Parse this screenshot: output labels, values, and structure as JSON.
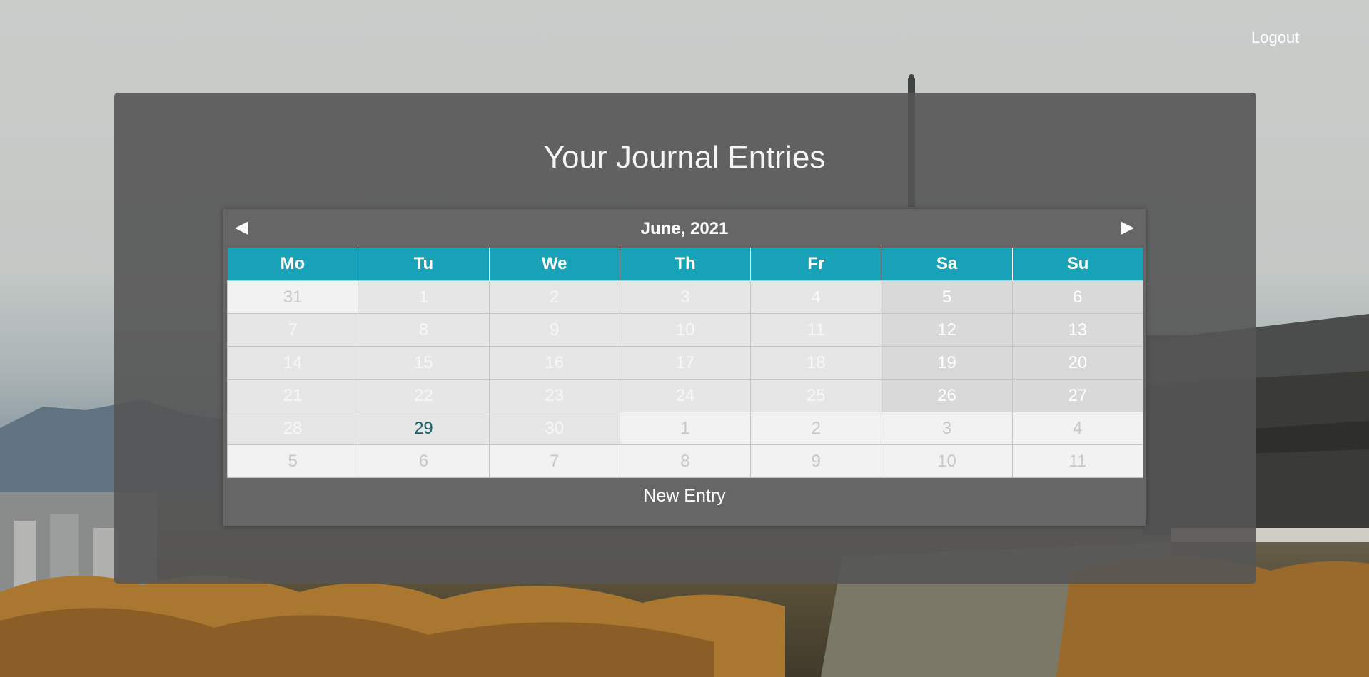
{
  "header": {
    "logout_label": "Logout"
  },
  "page": {
    "title": "Your Journal Entries"
  },
  "calendar": {
    "month_label": "June, 2021",
    "prev_icon": "◀",
    "next_icon": "▶",
    "weekdays": [
      "Mo",
      "Tu",
      "We",
      "Th",
      "Fr",
      "Sa",
      "Su"
    ],
    "weeks": [
      [
        {
          "day": "31",
          "state": "outside"
        },
        {
          "day": "1",
          "state": "in-month"
        },
        {
          "day": "2",
          "state": "in-month"
        },
        {
          "day": "3",
          "state": "in-month"
        },
        {
          "day": "4",
          "state": "in-month"
        },
        {
          "day": "5",
          "state": "weekend"
        },
        {
          "day": "6",
          "state": "weekend"
        }
      ],
      [
        {
          "day": "7",
          "state": "in-month"
        },
        {
          "day": "8",
          "state": "in-month"
        },
        {
          "day": "9",
          "state": "in-month"
        },
        {
          "day": "10",
          "state": "in-month"
        },
        {
          "day": "11",
          "state": "in-month"
        },
        {
          "day": "12",
          "state": "weekend"
        },
        {
          "day": "13",
          "state": "weekend"
        }
      ],
      [
        {
          "day": "14",
          "state": "in-month"
        },
        {
          "day": "15",
          "state": "in-month"
        },
        {
          "day": "16",
          "state": "in-month"
        },
        {
          "day": "17",
          "state": "in-month"
        },
        {
          "day": "18",
          "state": "in-month"
        },
        {
          "day": "19",
          "state": "weekend"
        },
        {
          "day": "20",
          "state": "weekend"
        }
      ],
      [
        {
          "day": "21",
          "state": "in-month"
        },
        {
          "day": "22",
          "state": "in-month"
        },
        {
          "day": "23",
          "state": "in-month"
        },
        {
          "day": "24",
          "state": "in-month"
        },
        {
          "day": "25",
          "state": "in-month"
        },
        {
          "day": "26",
          "state": "weekend"
        },
        {
          "day": "27",
          "state": "weekend"
        }
      ],
      [
        {
          "day": "28",
          "state": "in-month"
        },
        {
          "day": "29",
          "state": "today"
        },
        {
          "day": "30",
          "state": "in-month"
        },
        {
          "day": "1",
          "state": "outside"
        },
        {
          "day": "2",
          "state": "outside"
        },
        {
          "day": "3",
          "state": "outside"
        },
        {
          "day": "4",
          "state": "outside"
        }
      ],
      [
        {
          "day": "5",
          "state": "outside"
        },
        {
          "day": "6",
          "state": "outside"
        },
        {
          "day": "7",
          "state": "outside"
        },
        {
          "day": "8",
          "state": "outside"
        },
        {
          "day": "9",
          "state": "outside"
        },
        {
          "day": "10",
          "state": "outside"
        },
        {
          "day": "11",
          "state": "outside"
        }
      ]
    ],
    "new_entry_label": "New Entry"
  },
  "colors": {
    "header_accent": "#17a2b8",
    "today_text": "#1c5f6e",
    "panel": "#555555"
  }
}
